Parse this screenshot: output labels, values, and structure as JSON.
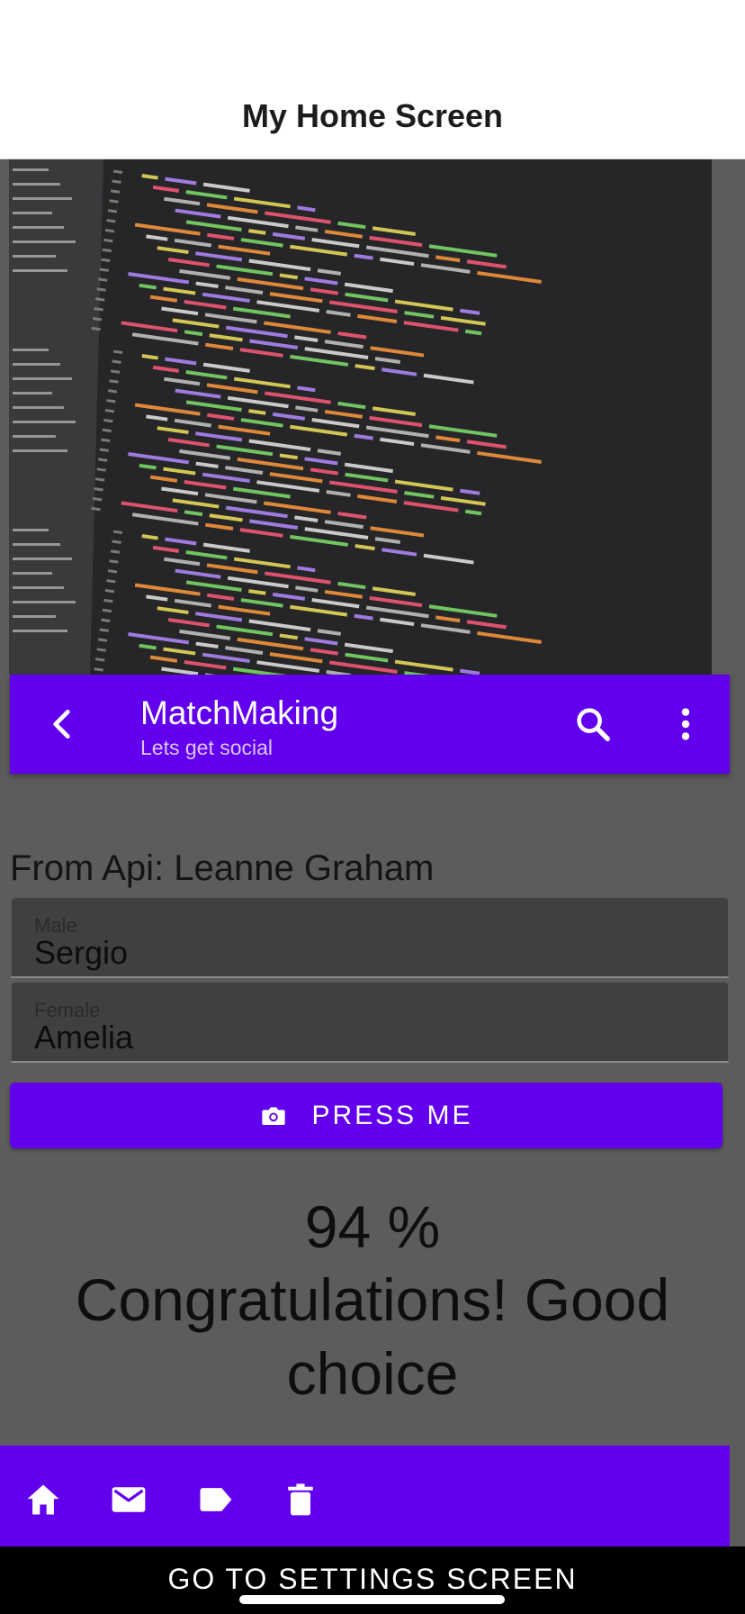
{
  "topnav": {
    "title": "My Home Screen"
  },
  "appbar": {
    "title": "MatchMaking",
    "subtitle": "Lets get social",
    "icons": {
      "back": "chevron-left-icon",
      "search": "search-icon",
      "more": "more-vert-icon"
    }
  },
  "content": {
    "from_api": "From Api: Leanne Graham",
    "male_field": {
      "label": "Male",
      "value": "Sergio"
    },
    "female_field": {
      "label": "Female",
      "value": "Amelia"
    },
    "press_button": {
      "label": "PRESS ME",
      "icon": "camera-icon"
    },
    "percent": "94 %",
    "message": "Congratulations! Good choice"
  },
  "bottombar": {
    "tabs": [
      {
        "icon": "home-icon"
      },
      {
        "icon": "mail-icon"
      },
      {
        "icon": "label-icon"
      },
      {
        "icon": "delete-icon"
      }
    ]
  },
  "footer": {
    "settings_link": "GO TO SETTINGS SCREEN"
  },
  "colors": {
    "accent": "#6200ee",
    "background": "#5c5c5c",
    "code_bg": "#262629"
  }
}
